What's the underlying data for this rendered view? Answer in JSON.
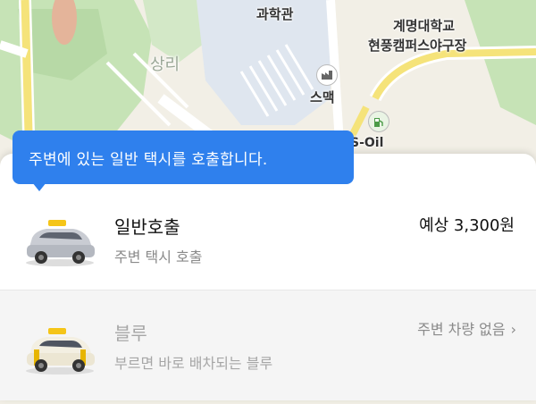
{
  "map": {
    "labels": {
      "science_hall": "과학관",
      "university": "계명대학교",
      "campus": "현풍캠퍼스야구장",
      "smack": "스맥",
      "district": "상리",
      "gas_station": "S-Oil"
    },
    "colors": {
      "green": "#c6e3b6",
      "water": "#dfe6ef",
      "road": "#f5e37a"
    }
  },
  "tooltip": {
    "text": "주변에 있는 일반 택시를 호출합니다."
  },
  "options": [
    {
      "title": "일반호출",
      "subtitle": "주변 택시 호출",
      "price": "예상 3,300원",
      "icon": "general-taxi-icon"
    },
    {
      "title": "블루",
      "subtitle": "부르면 바로 배차되는 블루",
      "status": "주변 차량 없음",
      "chevron": "›",
      "icon": "blue-taxi-icon"
    }
  ],
  "accent_color": "#2f80ed"
}
